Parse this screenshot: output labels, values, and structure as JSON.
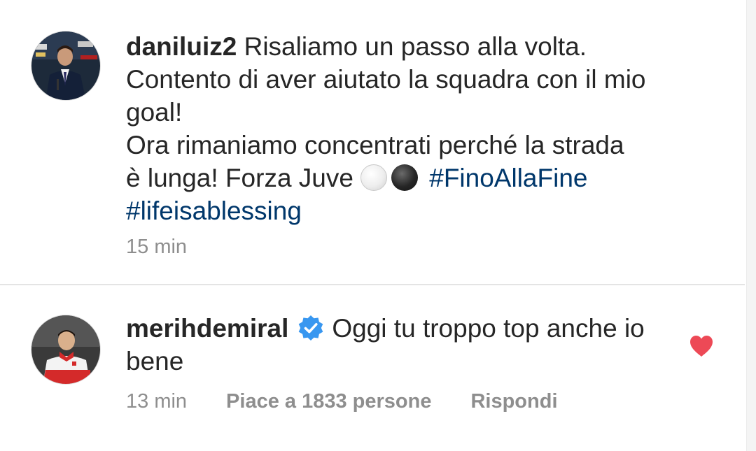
{
  "caption": {
    "username": "daniluiz2",
    "lines": [
      "Risaliamo un passo alla volta.",
      "Contento di aver aiutato la squadra con il mio",
      "goal!",
      "Ora rimaniamo concentrati perché la strada",
      "è lunga! Forza Juve"
    ],
    "hashtags": [
      "#FinoAllaFine",
      "#lifeisablessing"
    ],
    "emojis": [
      "white-circle",
      "black-circle"
    ],
    "time": "15 min"
  },
  "comment": {
    "username": "merihdemiral",
    "verified": true,
    "text_line1": "Oggi tu troppo top anche io",
    "text_line2": "bene",
    "time": "13 min",
    "likes_label": "Piace a 1833 persone",
    "reply_label": "Rispondi",
    "liked": true
  },
  "colors": {
    "text": "#262626",
    "secondary": "#8e8e8e",
    "hashtag": "#00376b",
    "verified": "#3897f0",
    "heart": "#ed4956"
  }
}
